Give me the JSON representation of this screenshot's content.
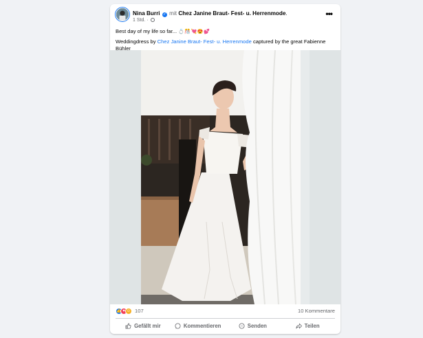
{
  "post": {
    "author": "Nina Burri",
    "with_word": "mit",
    "tagged_page": "Chez Janine Braut- Fest- u. Herrenmode",
    "header_suffix": ".",
    "time": "1 Std.",
    "separator": "·",
    "more_label": "•••",
    "line1": "Best day of my life so far...",
    "line1_emojis": "💍🎊💘😍💕",
    "line2_prefix": "Weddingdress by ",
    "line2_link": "Chez Janine Braut- Fest- u. Herrenmode",
    "line2_suffix": " captured by the great Fabienne Bühler"
  },
  "stats": {
    "reaction_icons": [
      "like",
      "love",
      "care"
    ],
    "reaction_count": "107",
    "comments_count": "10 Kommentare"
  },
  "actions": [
    {
      "label": "Gefällt mir",
      "icon": "thumbs-up-icon"
    },
    {
      "label": "Kommentieren",
      "icon": "comment-icon"
    },
    {
      "label": "Senden",
      "icon": "messenger-icon"
    },
    {
      "label": "Teilen",
      "icon": "share-icon"
    }
  ],
  "colors": {
    "page_background": "#f0f2f5",
    "card_background": "#ffffff",
    "link": "#1877f2",
    "secondary_text": "#65676b"
  }
}
